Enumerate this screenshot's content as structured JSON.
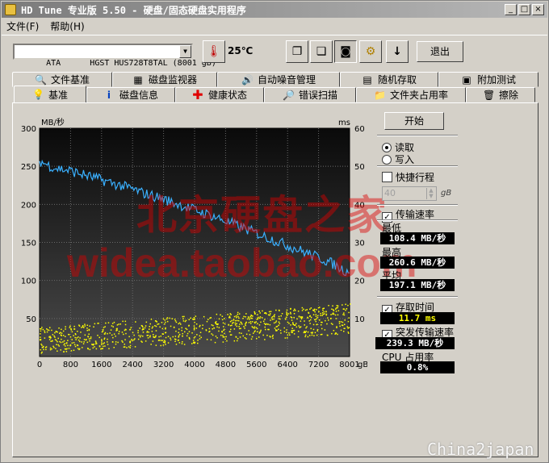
{
  "window": {
    "title": "HD Tune 专业版 5.50 - 硬盘/固态硬盘实用程序",
    "min_label": "_",
    "max_label": "□",
    "close_label": "×"
  },
  "menu": [
    {
      "label": "文件(F)"
    },
    {
      "label": "帮助(H)"
    }
  ],
  "toolbar": {
    "drive": "ATA      HGST HUS728T8TAL (8001 gB)",
    "temperature": "25℃",
    "exit_label": "退出"
  },
  "tabs_top": [
    {
      "label": "文件基准",
      "icon": "search-file-icon"
    },
    {
      "label": "磁盘监视器",
      "icon": "monitor-icon"
    },
    {
      "label": "自动噪音管理",
      "icon": "speaker-icon"
    },
    {
      "label": "随机存取",
      "icon": "random-icon"
    },
    {
      "label": "附加测试",
      "icon": "extra-test-icon"
    }
  ],
  "tabs_bottom": [
    {
      "label": "基准",
      "icon": "benchmark-icon"
    },
    {
      "label": "磁盘信息",
      "icon": "info-icon"
    },
    {
      "label": "健康状态",
      "icon": "health-icon"
    },
    {
      "label": "错误扫描",
      "icon": "scan-icon"
    },
    {
      "label": "文件夹占用率",
      "icon": "folder-icon"
    },
    {
      "label": "擦除",
      "icon": "trash-icon"
    }
  ],
  "side": {
    "start_label": "开始",
    "read_label": "读取",
    "write_label": "写入",
    "quick_label": "快捷行程",
    "quick_value": "40",
    "quick_unit": "gB",
    "transfer_label": "传输速率",
    "min_label": "最低",
    "min_value": "108.4 MB/秒",
    "max_label": "最高",
    "max_value": "260.6 MB/秒",
    "avg_label": "平均",
    "avg_value": "197.1 MB/秒",
    "access_label": "存取时间",
    "access_value": "11.7 ms",
    "burst_label": "突发传输速率",
    "burst_value": "239.3 MB/秒",
    "cpu_label": "CPU 占用率",
    "cpu_value": "0.8%"
  },
  "watermarks": {
    "line1": "北京硬盘之家",
    "line2": "widea.taobao.com",
    "corner": "China2japan"
  },
  "chart_data": {
    "type": "line",
    "ylabel": "MB/秒",
    "y2label": "ms",
    "xunit": "gB",
    "x_ticks": [
      "0",
      "800",
      "1600",
      "2400",
      "3200",
      "4000",
      "4800",
      "5600",
      "6400",
      "7200",
      "8001"
    ],
    "y_ticks": [
      "50",
      "100",
      "150",
      "200",
      "250",
      "300"
    ],
    "y2_ticks": [
      "10",
      "20",
      "30",
      "40",
      "50",
      "60"
    ],
    "xlim": [
      0,
      8001
    ],
    "ylim": [
      0,
      300
    ],
    "y2lim": [
      0,
      60
    ],
    "grid": true,
    "series": [
      {
        "color": "#3ab0ff",
        "x": [
          0,
          200,
          400,
          600,
          800,
          1000,
          1200,
          1400,
          1600,
          1800,
          2000,
          2200,
          2400,
          2600,
          2800,
          3000,
          3200,
          3400,
          3600,
          3800,
          4000,
          4200,
          4400,
          4600,
          4800,
          5000,
          5200,
          5400,
          5600,
          5800,
          6000,
          6200,
          6400,
          6600,
          6800,
          7000,
          7200,
          7400,
          7600,
          7800,
          8001
        ],
        "values": [
          257,
          252,
          248,
          246,
          244,
          241,
          238,
          235,
          232,
          229,
          226,
          223,
          220,
          216,
          213,
          210,
          207,
          203,
          200,
          196,
          193,
          189,
          186,
          182,
          178,
          174,
          170,
          166,
          162,
          158,
          154,
          150,
          146,
          142,
          138,
          134,
          130,
          126,
          121,
          115,
          110
        ]
      }
    ],
    "access_time": {
      "color": "#ffff00",
      "axis": "y2",
      "band_start": [
        1,
        8
      ],
      "band_end": [
        6,
        14
      ]
    }
  }
}
